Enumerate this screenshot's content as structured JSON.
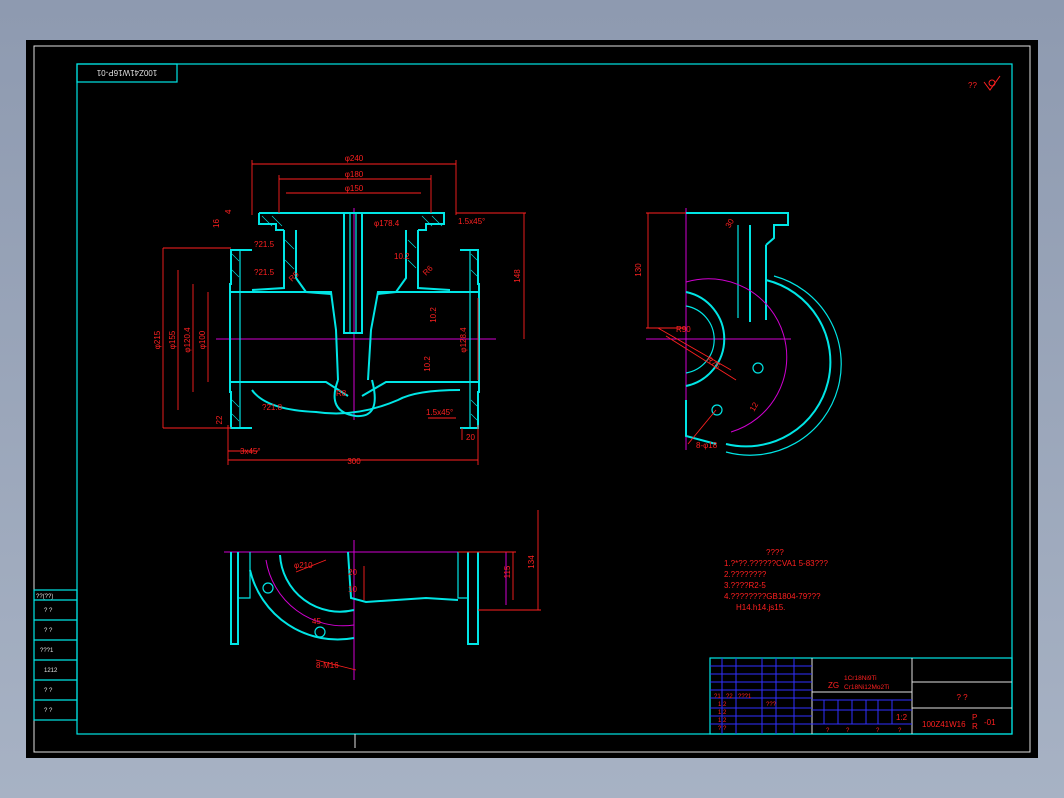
{
  "drawing_number": "100Z41W16P-01",
  "corner_mark": "??",
  "dimensions": {
    "d240": "φ240",
    "d180": "φ180",
    "d150": "φ150",
    "d178": "φ178.4",
    "t16": "16",
    "t4": "4",
    "chamfer1": "1.5x45°",
    "r215": "?21.5",
    "r15a": "?21.5",
    "d215": "φ215",
    "d155": "φ155",
    "d1204": "φ120.4",
    "d100": "φ100",
    "d1284": "φ128.4",
    "h102a": "10.2",
    "h102b": "10.2",
    "h102c": "10.2",
    "r5": "R5",
    "r6": "R6",
    "r8": "R8",
    "r218": "?21.8",
    "h148": "148",
    "h22": "22",
    "c15": "1.5x45°",
    "h20": "20",
    "c3": "3x45°",
    "l300": "300",
    "h130": "130",
    "r30": "30",
    "r90": "R90",
    "r75": "R75",
    "h12": "12",
    "bolt1": "8-φ18",
    "d210": "φ210",
    "s20": "20",
    "s10": "10",
    "s45": "45",
    "h115": "115",
    "h134": "134",
    "bolt2": "8-M16"
  },
  "notes": {
    "title": "????",
    "lines": [
      "1.?*??.??????CVA1 5-83???",
      "2.????????",
      "3.????R2-5",
      "4.????????GB1804-79???",
      "   H14.h14.js15."
    ]
  },
  "title_block": {
    "material_label": "ZG",
    "material_line1": "1Cr18Ni9Ti",
    "material_line2": "Cr18Ni12Mo2Ti",
    "name": "?  ?",
    "scale": "1:2",
    "number_prefix": "100Z41W16",
    "number_p": "P",
    "number_r": "R",
    "number_suffix": "-01",
    "cells": [
      "?1",
      "?2",
      "???1",
      "1 2",
      "1 2",
      "1 2",
      "?  ?",
      "???",
      "?",
      "?",
      "?",
      "?"
    ]
  },
  "side_table": {
    "rows": [
      "??(??)",
      "?   ?",
      "?   ?",
      "???1",
      "1212",
      "?   ?",
      "?   ?"
    ]
  }
}
